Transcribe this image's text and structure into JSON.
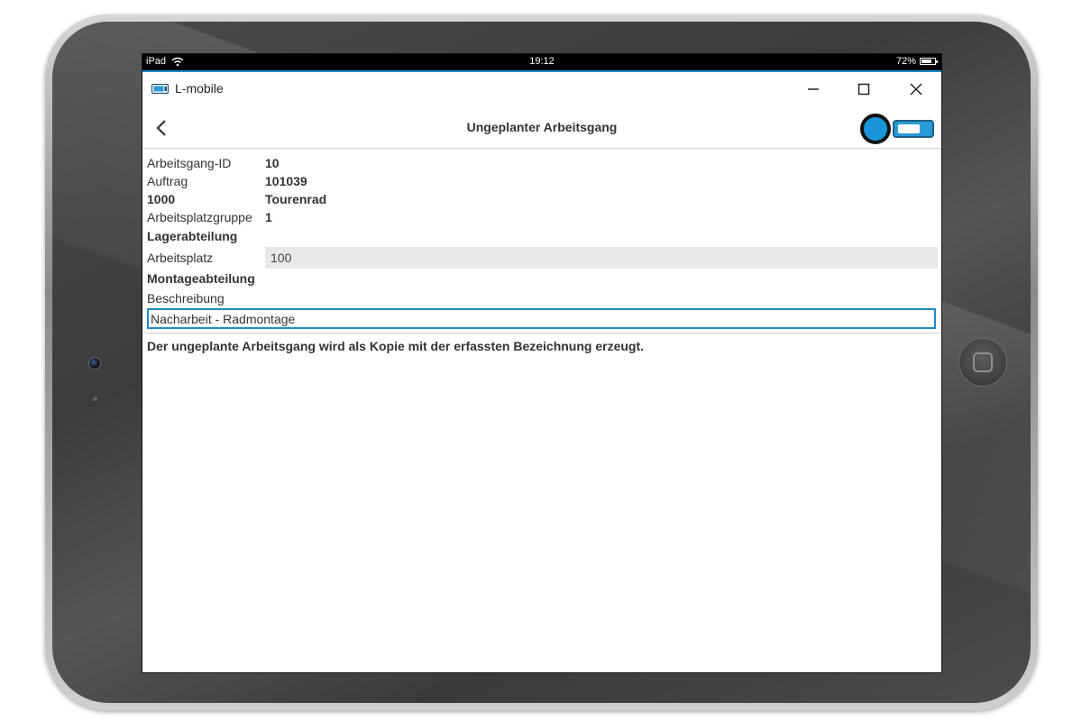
{
  "statusbar": {
    "device": "iPad",
    "time": "19:12",
    "battery": "72%"
  },
  "window": {
    "title": "L-mobile"
  },
  "header": {
    "title": "Ungeplanter Arbeitsgang"
  },
  "details": {
    "operation_id_label": "Arbeitsgang-ID",
    "operation_id_value": "10",
    "order_label": "Auftrag",
    "order_value": "101039",
    "article_number": "1000",
    "article_name": "Tourenrad",
    "workgroup_label": "Arbeitsplatzgruppe",
    "workgroup_value": "1",
    "workgroup_name": "Lagerabteilung",
    "workplace_label": "Arbeitsplatz",
    "workplace_value": "100",
    "workplace_name": "Montageabteilung",
    "description_label": "Beschreibung",
    "description_value": "Nacharbeit - Radmontage"
  },
  "info": {
    "message": "Der ungeplante Arbeitsgang wird als Kopie mit der erfassten Bezeichnung erzeugt."
  },
  "colors": {
    "accent": "#1f8cc8",
    "toggle": "#1b95d9"
  }
}
